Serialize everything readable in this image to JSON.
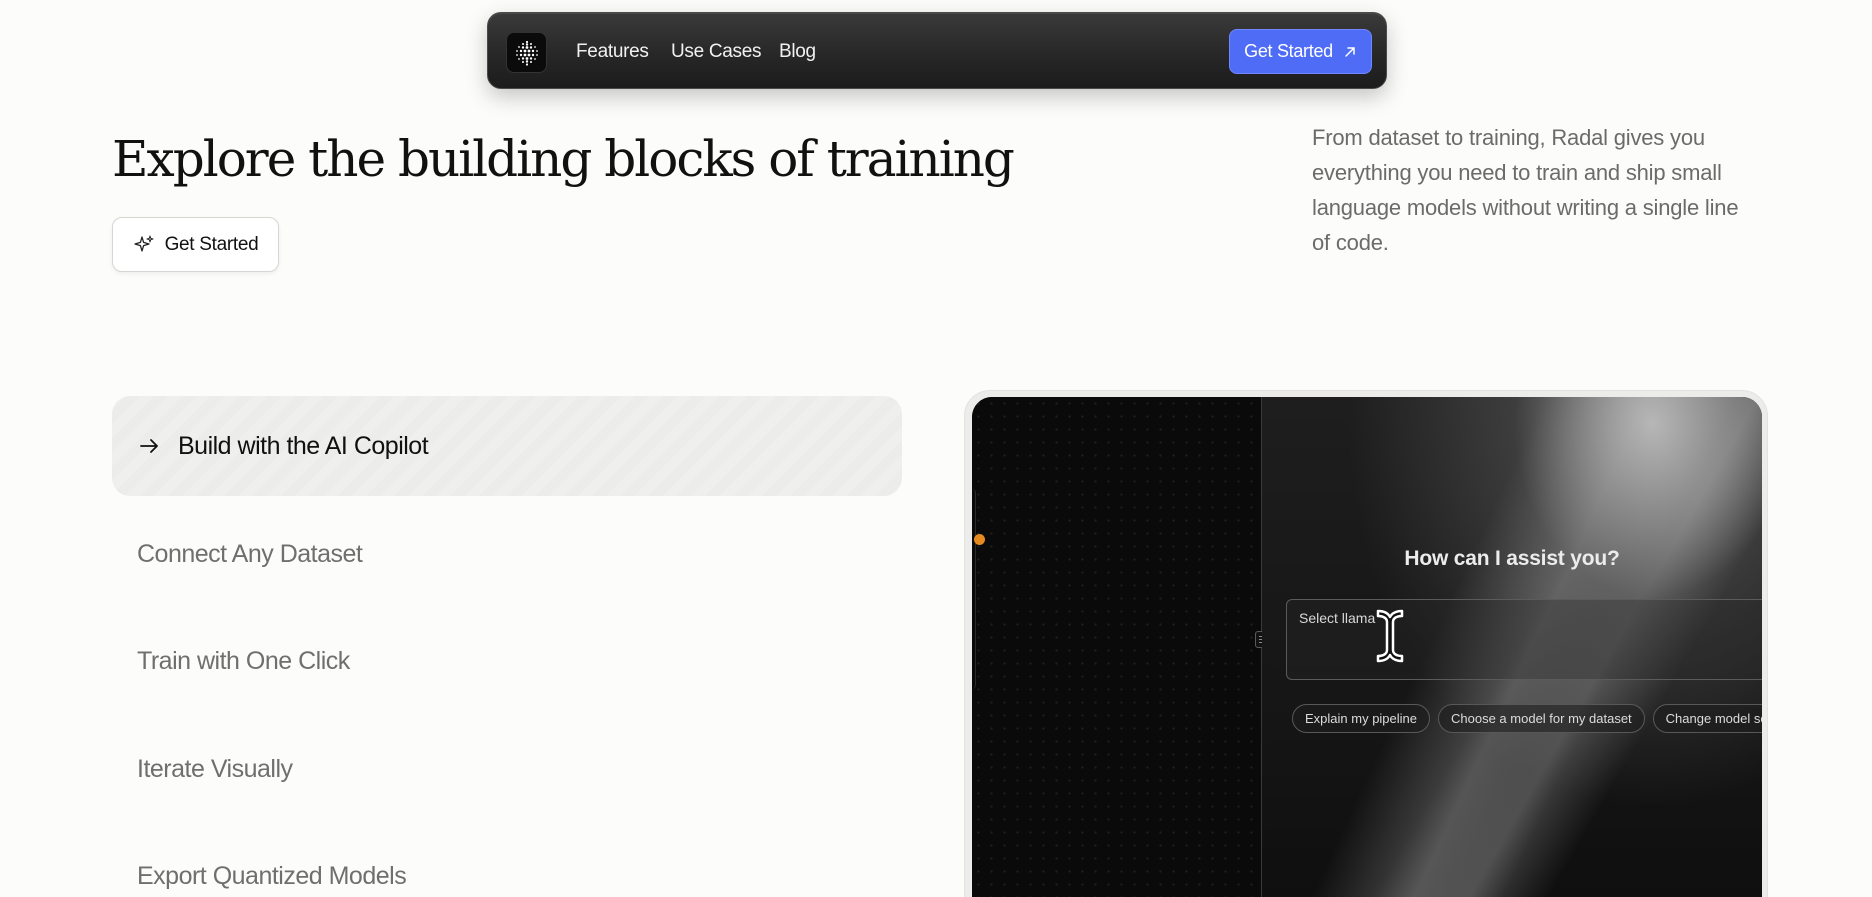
{
  "nav": {
    "logo_icon": "dotted-grid-logo-icon",
    "links": [
      {
        "label": "Features"
      },
      {
        "label": "Use Cases"
      },
      {
        "label": "Blog"
      }
    ],
    "cta_label": "Get Started",
    "cta_icon": "arrow-up-right-icon",
    "cta_color": "#4e6cf5"
  },
  "hero": {
    "title": "Explore the building blocks of training",
    "button_label": "Get Started",
    "button_icon": "sparkle-icon",
    "description": "From dataset to training, Radal gives you everything you need to train and ship small language models without writing a single line of code."
  },
  "features": {
    "active": {
      "label": "Build with the AI Copilot",
      "icon": "arrow-right-icon"
    },
    "items": [
      {
        "label": "Connect Any Dataset"
      },
      {
        "label": "Train with One Click"
      },
      {
        "label": "Iterate Visually"
      },
      {
        "label": "Export Quantized Models"
      }
    ]
  },
  "demo": {
    "chat_title": "How can I assist you?",
    "input_value": "Select llama",
    "suggestions": [
      {
        "label": "Explain my pipeline"
      },
      {
        "label": "Choose a model for my dataset"
      },
      {
        "label": "Change model se"
      }
    ],
    "accent_dot_color": "#e48a1f"
  }
}
